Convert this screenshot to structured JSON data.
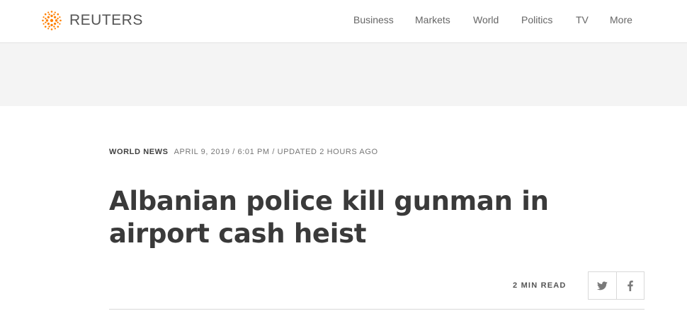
{
  "brand": {
    "name": "REUTERS",
    "logo_color": "#ff8000"
  },
  "nav": {
    "items": [
      {
        "label": "Business"
      },
      {
        "label": "Markets"
      },
      {
        "label": "World"
      },
      {
        "label": "Politics"
      },
      {
        "label": "TV"
      },
      {
        "label": "More"
      }
    ]
  },
  "article": {
    "section": "WORLD NEWS",
    "dateline": "APRIL 9, 2019 / 6:01 PM / UPDATED 2 HOURS AGO",
    "headline": "Albanian police kill gunman in airport cash heist",
    "read_time": "2 MIN READ"
  },
  "share": {
    "icons": [
      "twitter-icon",
      "facebook-icon"
    ]
  },
  "colors": {
    "ad_band": "#f4f4f4",
    "text_dark": "#404040",
    "text_muted": "#767676"
  }
}
